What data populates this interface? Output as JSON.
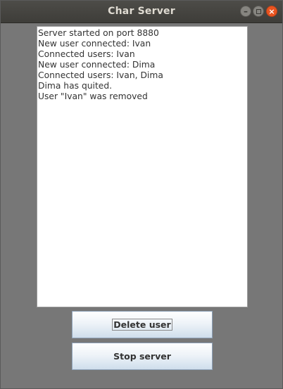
{
  "window": {
    "title": "Char Server",
    "controls": {
      "minimize": "–",
      "close": "×"
    }
  },
  "log": {
    "lines": [
      "Server started on port 8880",
      "New user connected: Ivan",
      "Connected users: Ivan",
      "New user connected: Dima",
      "Connected users: Ivan, Dima",
      "Dima has quited.",
      "User \"Ivan\" was removed"
    ]
  },
  "buttons": {
    "delete_user": "Delete user",
    "stop_server": "Stop server"
  },
  "colors": {
    "titlebar": "#3e3d39",
    "close_button": "#e95420",
    "window_background": "#777777"
  }
}
